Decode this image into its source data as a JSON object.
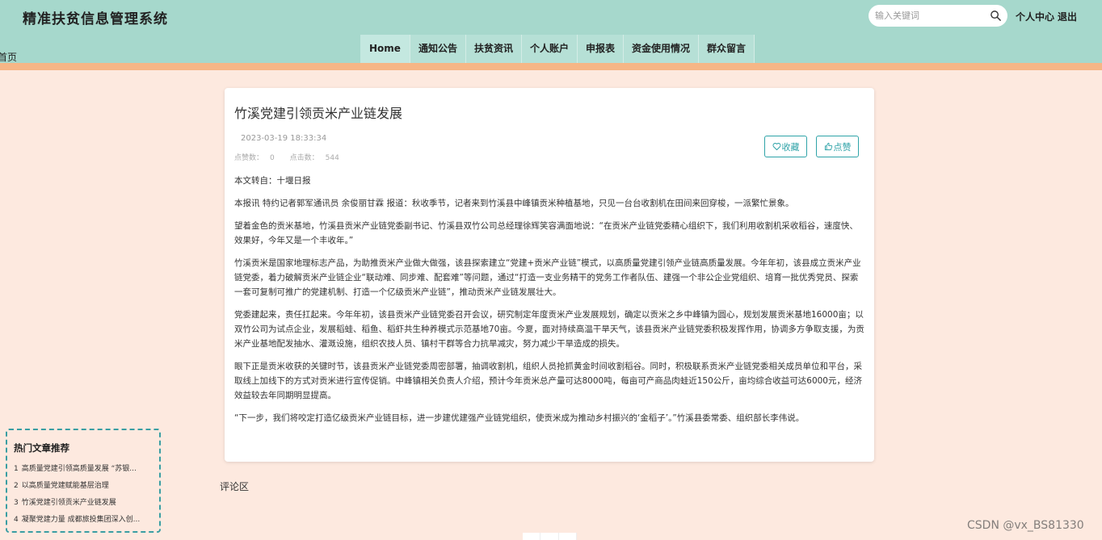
{
  "header": {
    "site_title": "精准扶贫信息管理系统",
    "fragment_text": "首页",
    "search_placeholder": "输入关键词",
    "user_center": "个人中心",
    "logout": "退出"
  },
  "nav": {
    "items": [
      "Home",
      "通知公告",
      "扶贫资讯",
      "个人账户",
      "申报表",
      "资金使用情况",
      "群众留言"
    ],
    "active_index": 0
  },
  "article": {
    "title": "竹溪党建引领贡米产业链发展",
    "date": "2023-03-19 18:33:34",
    "likes_label": "点赞数：",
    "likes": "0",
    "clicks_label": "点击数：",
    "clicks": "544",
    "collect_label": "收藏",
    "like_label": "点赞",
    "paragraphs": [
      "本文转自：十堰日报",
      "本报讯 特约记者郭军通讯员 余俊丽甘霖 报道：秋收季节，记者来到竹溪县中峰镇贡米种植基地，只见一台台收割机在田间来回穿梭，一派繁忙景象。",
      "望着金色的贡米基地，竹溪县贡米产业链党委副书记、竹溪县双竹公司总经理徐辉笑容满面地说：“在贡米产业链党委精心组织下，我们利用收割机采收稻谷，速度快、效果好，今年又是一个丰收年。”",
      "竹溪贡米是国家地理标志产品，为助推贡米产业做大做强，该县探索建立“党建+贡米产业链”模式，以高质量党建引领产业链高质量发展。今年年初，该县成立贡米产业链党委，着力破解贡米产业链企业“联动难、同步难、配套难”等问题，通过“打造一支业务精干的党务工作者队伍、建强一个非公企业党组织、培育一批优秀党员、探索一套可复制可推广的党建机制、打造一个亿级贡米产业链”，推动贡米产业链发展壮大。",
      "党委建起来，责任扛起来。今年年初，该县贡米产业链党委召开会议，研究制定年度贡米产业发展规划，确定以贡米之乡中峰镇为圆心，规划发展贡米基地16000亩；以双竹公司为试点企业，发展稻蛙、稻鱼、稻虾共生种养模式示范基地70亩。今夏，面对持续高温干旱天气，该县贡米产业链党委积极发挥作用，协调多方争取支援，为贡米产业基地配发抽水、灌溉设施，组织农技人员、镇村干群等合力抗旱减灾，努力减少干旱造成的损失。",
      "眼下正是贡米收获的关键时节，该县贡米产业链党委周密部署，抽调收割机，组织人员抢抓黄金时间收割稻谷。同时，积极联系贡米产业链党委相关成员单位和平台，采取线上加线下的方式对贡米进行宣传促销。中峰镇相关负责人介绍，预计今年贡米总产量可达8000吨，每亩可产商品肉蛙近150公斤，亩均综合收益可达6000元，经济效益较去年同期明显提高。",
      "“下一步，我们将咬定打造亿级贡米产业链目标，进一步建优建强产业链党组织，使贡米成为推动乡村振兴的‘金稻子’。”竹溪县委常委、组织部长李伟说。"
    ]
  },
  "hot": {
    "title": "热门文章推荐",
    "items": [
      {
        "num": "1",
        "text": "高质量党建引领高质量发展 “苏银..."
      },
      {
        "num": "2",
        "text": "以高质量党建赋能基层治理"
      },
      {
        "num": "3",
        "text": "竹溪党建引领贡米产业链发展"
      },
      {
        "num": "4",
        "text": "凝聚党建力量 成都旅投集团深入创..."
      }
    ]
  },
  "comments": {
    "label": "评论区"
  },
  "watermark": "CSDN @vx_BS81330",
  "colors": {
    "header_bg": "#a6d8cc",
    "accent_strip": "#f6b686",
    "page_bg": "#fde9df",
    "button_accent": "#2fa3a8"
  }
}
